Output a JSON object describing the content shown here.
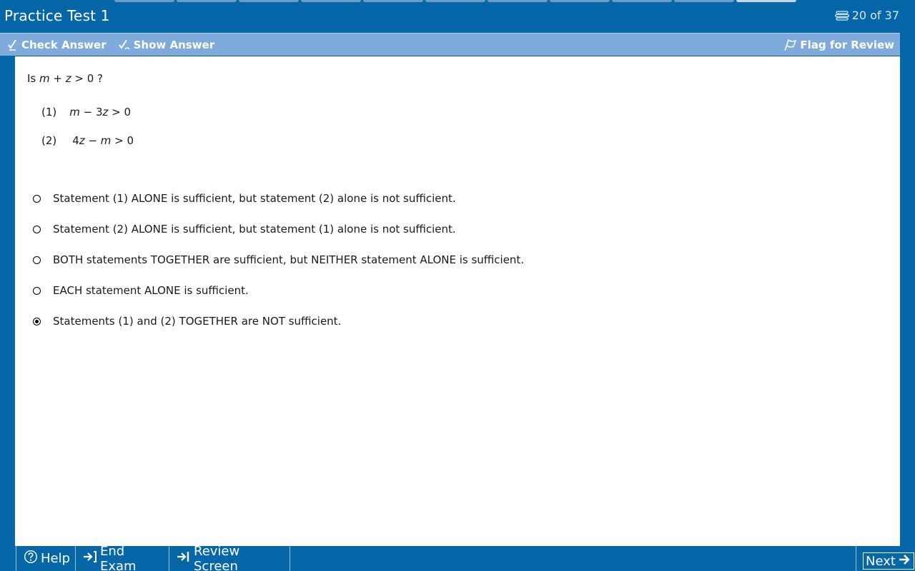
{
  "header": {
    "title": "Practice Test 1",
    "progress": "20 of 37"
  },
  "toolbar": {
    "check_answer": "Check Answer",
    "show_answer": "Show Answer",
    "flag_review": "Flag for Review"
  },
  "question": {
    "prompt_prefix": "Is ",
    "prompt_var1": "m",
    "prompt_op": " + ",
    "prompt_var2": "z",
    "prompt_suffix": " > 0 ?",
    "statements": [
      {
        "num": "(1)",
        "expr_var1": "m",
        "expr_mid": " − 3",
        "expr_var2": "z",
        "expr_end": " > 0"
      },
      {
        "num": "(2)",
        "expr_pre": "4",
        "expr_var1": "z",
        "expr_mid": " − ",
        "expr_var2": "m",
        "expr_end": " > 0"
      }
    ]
  },
  "choices": [
    {
      "label": "Statement (1) ALONE is sufficient, but statement (2) alone is not sufficient.",
      "selected": false
    },
    {
      "label": "Statement (2) ALONE is sufficient, but statement (1) alone is not sufficient.",
      "selected": false
    },
    {
      "label": "BOTH statements TOGETHER are sufficient, but NEITHER statement ALONE is sufficient.",
      "selected": false
    },
    {
      "label": "EACH statement ALONE is sufficient.",
      "selected": false
    },
    {
      "label": "Statements (1) and (2) TOGETHER are NOT sufficient.",
      "selected": true
    }
  ],
  "footer": {
    "help": "Help",
    "end_exam": "End Exam",
    "review_screen": "Review Screen",
    "next": "Next"
  },
  "icons": {
    "progress": "stack-icon",
    "check": "check-pencil-icon",
    "show": "show-pencil-icon",
    "flag": "flag-icon",
    "help": "question-circle-icon",
    "end": "exit-arrow-icon",
    "review": "review-arrow-icon",
    "next": "arrow-right-icon"
  },
  "colors": {
    "background": "#0567a8",
    "toolbar": "#7eabdc",
    "content": "#ffffff"
  }
}
